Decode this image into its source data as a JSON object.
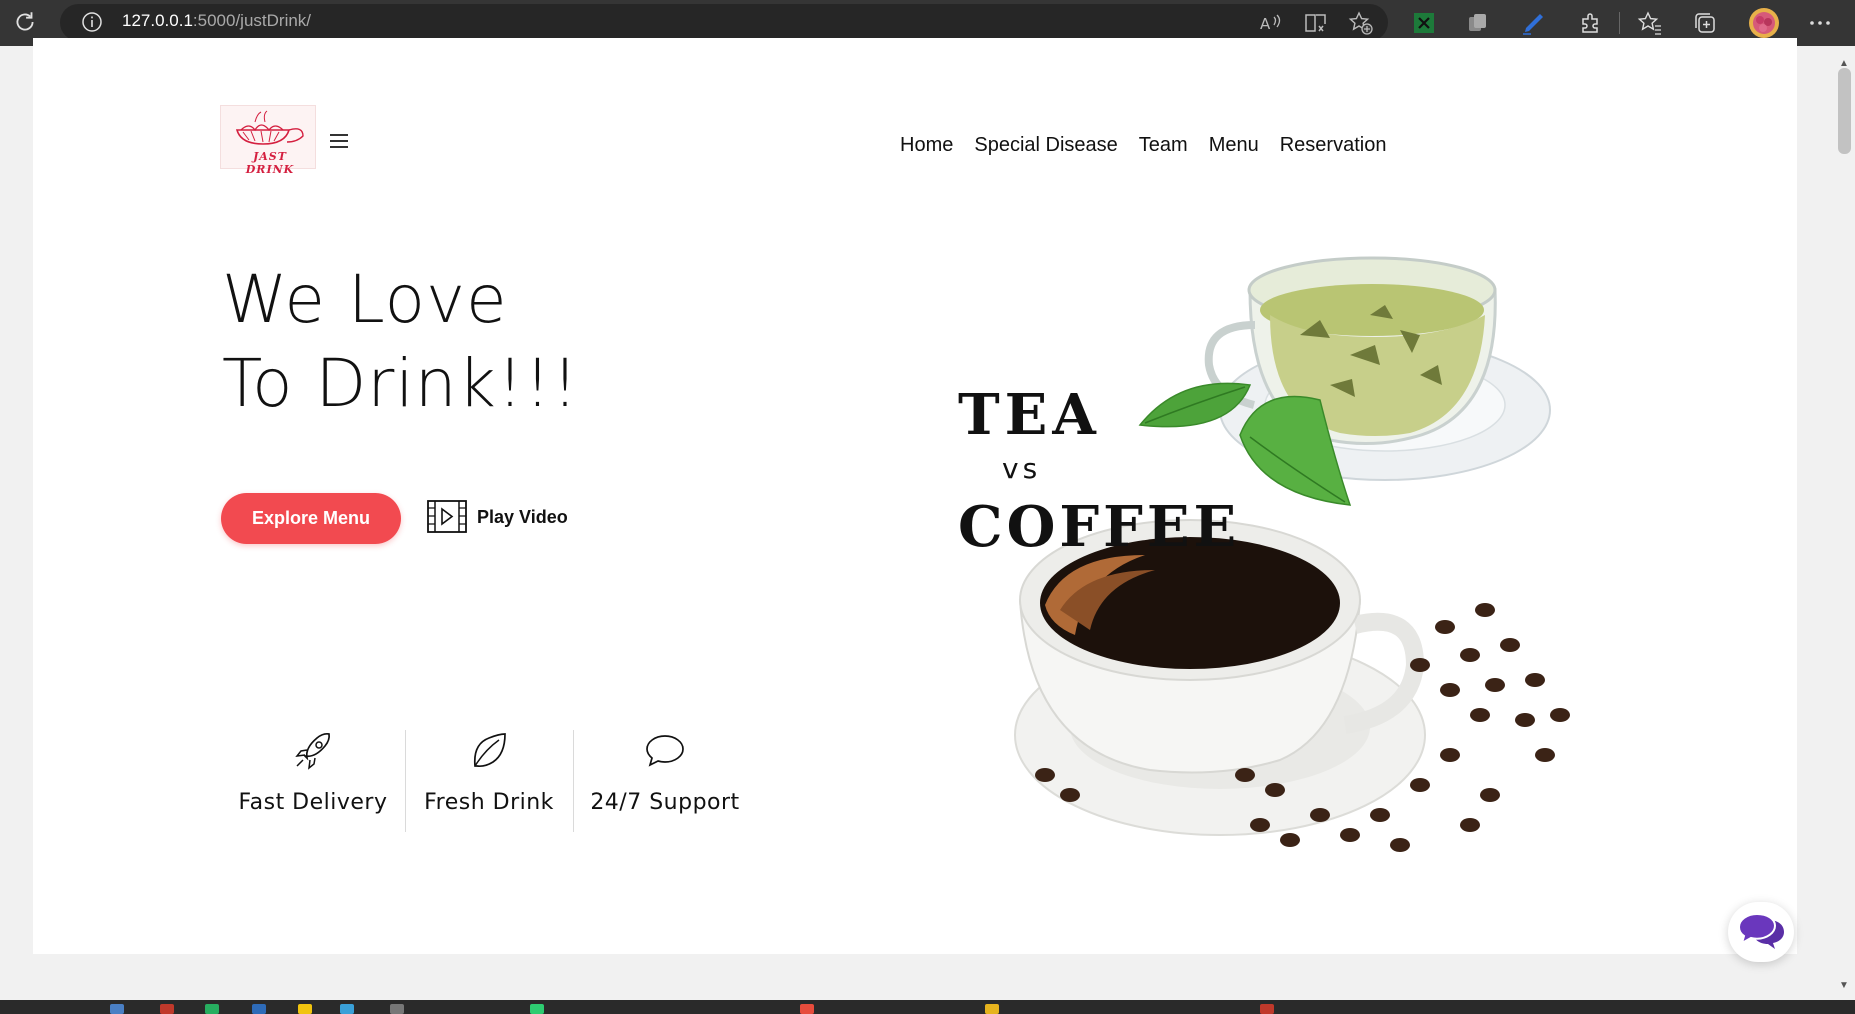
{
  "browser": {
    "url_host": "127.0.0.1",
    "url_rest": ":5000/justDrink/",
    "toolbar_icons": [
      "reload-icon",
      "site-info-icon",
      "read-aloud-icon",
      "immersive-reader-icon",
      "add-favorite-icon",
      "excel-extension-icon",
      "copy-extension-icon",
      "pen-extension-icon",
      "extensions-icon",
      "favorites-icon",
      "collections-icon",
      "profile-avatar",
      "more-options-icon"
    ]
  },
  "header": {
    "logo_text": "JAST DRINK",
    "nav": [
      "Home",
      "Special Disease",
      "Team",
      "Menu",
      "Reservation"
    ]
  },
  "hero": {
    "title_line1": "We Love",
    "title_line2": "To Drink!!!",
    "explore_button": "Explore Menu",
    "play_video": "Play Video"
  },
  "features": [
    {
      "label": "Fast Delivery",
      "icon": "rocket-icon"
    },
    {
      "label": "Fresh Drink",
      "icon": "leaf-icon"
    },
    {
      "label": "24/7 Support",
      "icon": "chat-bubble-icon"
    }
  ],
  "hero_image": {
    "word1": "TEA",
    "word2": "vs",
    "word3": "COFFEE"
  },
  "colors": {
    "accent": "#f24a50",
    "chat": "#5a2ea6",
    "browser_bar": "#353535"
  }
}
